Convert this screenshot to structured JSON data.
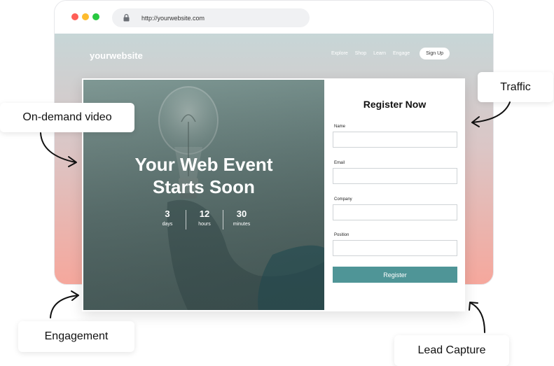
{
  "browser": {
    "url": "http://yourwebsite.com"
  },
  "site": {
    "logo": "yourwebsite",
    "nav": [
      "Explore",
      "Shop",
      "Learn",
      "Engage"
    ],
    "signup_label": "Sign Up"
  },
  "hero": {
    "title_line1": "Your Web Event",
    "title_line2": "Starts Soon",
    "countdown": [
      {
        "value": "3",
        "unit": "days"
      },
      {
        "value": "12",
        "unit": "hours"
      },
      {
        "value": "30",
        "unit": "minutes"
      }
    ]
  },
  "form": {
    "title": "Register Now",
    "fields": [
      {
        "label": "Name"
      },
      {
        "label": "Email"
      },
      {
        "label": "Company"
      },
      {
        "label": "Position"
      }
    ],
    "submit_label": "Register"
  },
  "callouts": {
    "video": "On-demand video",
    "traffic": "Traffic",
    "engagement": "Engagement",
    "lead_capture": "Lead Capture"
  }
}
